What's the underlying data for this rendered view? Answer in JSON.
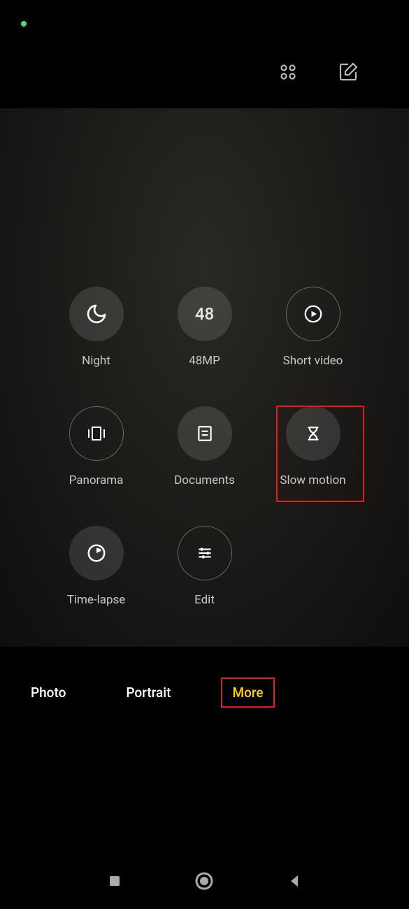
{
  "status": {},
  "topbar": {
    "layout_icon": "grid-icon",
    "edit_icon": "edit-icon"
  },
  "modes": [
    {
      "id": "night",
      "label": "Night",
      "icon": "moon",
      "style": "filled"
    },
    {
      "id": "48mp",
      "label": "48MP",
      "icon_text": "48",
      "style": "filled"
    },
    {
      "id": "short-video",
      "label": "Short video",
      "icon": "play-circle",
      "style": "outlined"
    },
    {
      "id": "panorama",
      "label": "Panorama",
      "icon": "panorama",
      "style": "outlined"
    },
    {
      "id": "documents",
      "label": "Documents",
      "icon": "document",
      "style": "filled"
    },
    {
      "id": "slow-motion",
      "label": "Slow motion",
      "icon": "hourglass",
      "style": "filled",
      "highlighted": true
    },
    {
      "id": "time-lapse",
      "label": "Time-lapse",
      "icon": "clock-quarter",
      "style": "filled"
    },
    {
      "id": "edit",
      "label": "Edit",
      "icon": "sliders",
      "style": "outlined"
    }
  ],
  "tabs": [
    {
      "label": "Photo",
      "active": false
    },
    {
      "label": "Portrait",
      "active": false
    },
    {
      "label": "More",
      "active": true
    }
  ],
  "nav": {
    "recent": "recent-apps",
    "home": "home",
    "back": "back"
  }
}
